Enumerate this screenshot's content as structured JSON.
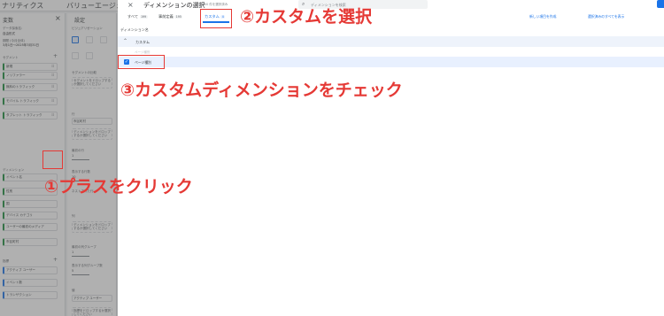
{
  "app": {
    "title_left": "ナリティクス",
    "title_right": "バリューエージェント(各種..."
  },
  "variables": {
    "title": "変数",
    "exploration_name_label": "データ探索名:",
    "exploration_name": "自由形式",
    "date_label": "期間 (今月全体)",
    "date_value": "3月1日～2025年3月31日",
    "segments_label": "セグメント",
    "segments": [
      "新規",
      "ノリファラー",
      "無料のトラフィック",
      "モバイル トラフィック",
      "タブレット トラフィック"
    ],
    "dimensions_label": "ディメンション",
    "dimensions": [
      "イベント名",
      "性別",
      "国",
      "デバイス カテゴリ",
      "ユーザーの最初のメディア",
      "市区町村"
    ],
    "metrics_label": "指標",
    "metrics": [
      "アクティブ ユーザー",
      "イベント数",
      "トランザクション"
    ]
  },
  "settings": {
    "title": "設定",
    "technique_label": "ビジュアリゼーション",
    "segment_compare_label": "セグメントの比較",
    "segment_drop": "セグメントをドロップするか選択してください",
    "rows_label": "行",
    "rows_chip": "市区町村",
    "rows_drop": "ディメンションをドロップするか選択してください",
    "start_row_label": "最初の行",
    "start_row": "1",
    "show_rows_label": "表示する行数",
    "show_rows": "10",
    "nested_rows_label": "ネストされた行",
    "columns_label": "列",
    "columns_drop": "ディメンションをドロップするか選択してください",
    "col_group_label": "最初の列グループ",
    "col_group": "1",
    "show_cols_label": "表示する列グループ数",
    "show_cols": "5",
    "values_label": "値",
    "values_chip": "アクティブ ユーザー",
    "values_drop": "指標をドロップするか選択してください"
  },
  "dialog": {
    "close": "×",
    "title": "ディメンションの選択",
    "count": "5 /500 件を選択済み",
    "search_placeholder": "ディメンションを検索",
    "tabs": [
      {
        "label": "すべて",
        "count": "199"
      },
      {
        "label": "事前定義",
        "count": "195"
      },
      {
        "label": "カスタム",
        "count": "4"
      }
    ],
    "link_create": "新しい項目を作成",
    "link_show_selected": "選択済みのすべてを表示",
    "section_header": "ディメンション名",
    "group_label": "カスタム",
    "ghost_row": "ページ種別",
    "checked_row": "ページ種別"
  },
  "annotations": {
    "step2": "②カスタムを選択",
    "step3": "③カスタムディメンションをチェック",
    "step1": "①プラスをクリック"
  },
  "colors": {
    "annotation": "#e53935",
    "accent": "#1a73e8",
    "dimension_chip": "#1e8e3e"
  }
}
